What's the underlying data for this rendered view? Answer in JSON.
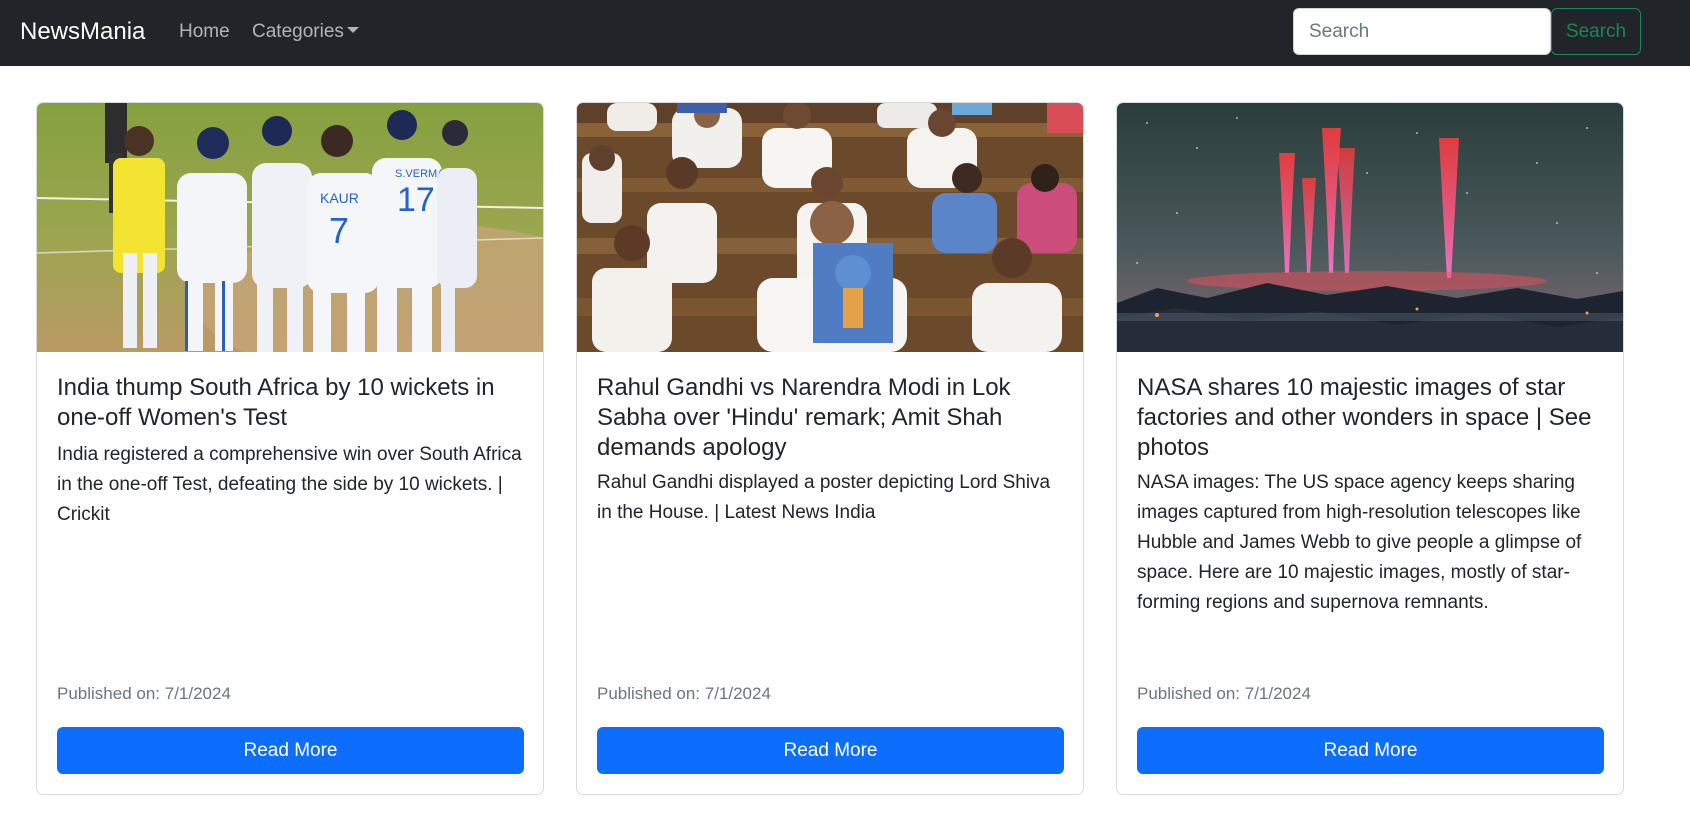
{
  "navbar": {
    "brand": "NewsMania",
    "home_label": "Home",
    "categories_label": "Categories",
    "search_placeholder": "Search",
    "search_value": "",
    "search_button": "Search",
    "colors": {
      "background": "#212529",
      "search_outline": "#198754"
    }
  },
  "cards": [
    {
      "title": "India thump South Africa by 10 wickets in one-off Women's Test",
      "description": "India registered a comprehensive win over South Africa in the one-off Test, defeating the side by 10 wickets. | Crickit",
      "published": "Published on: 7/1/2024",
      "button": "Read More",
      "image": "cricket-team-celebration-image"
    },
    {
      "title": "Rahul Gandhi vs Narendra Modi in Lok Sabha over 'Hindu' remark; Amit Shah demands apology",
      "description": "Rahul Gandhi displayed a poster depicting Lord Shiva in the House. | Latest News India",
      "published": "Published on: 7/1/2024",
      "button": "Read More",
      "image": "lok-sabha-session-image"
    },
    {
      "title": "NASA shares 10 majestic images of star factories and other wonders in space | See photos",
      "description": "NASA images: The US space agency keeps sharing images captured from high-resolution telescopes like Hubble and James Webb to give people a glimpse of space. Here are 10 majestic images, mostly of star-forming regions and supernova remnants.",
      "published": "Published on: 7/1/2024",
      "button": "Read More",
      "image": "night-sky-red-sprites-image"
    }
  ],
  "colors": {
    "primary_button": "#0d6efd",
    "muted_text": "#6c757d"
  }
}
